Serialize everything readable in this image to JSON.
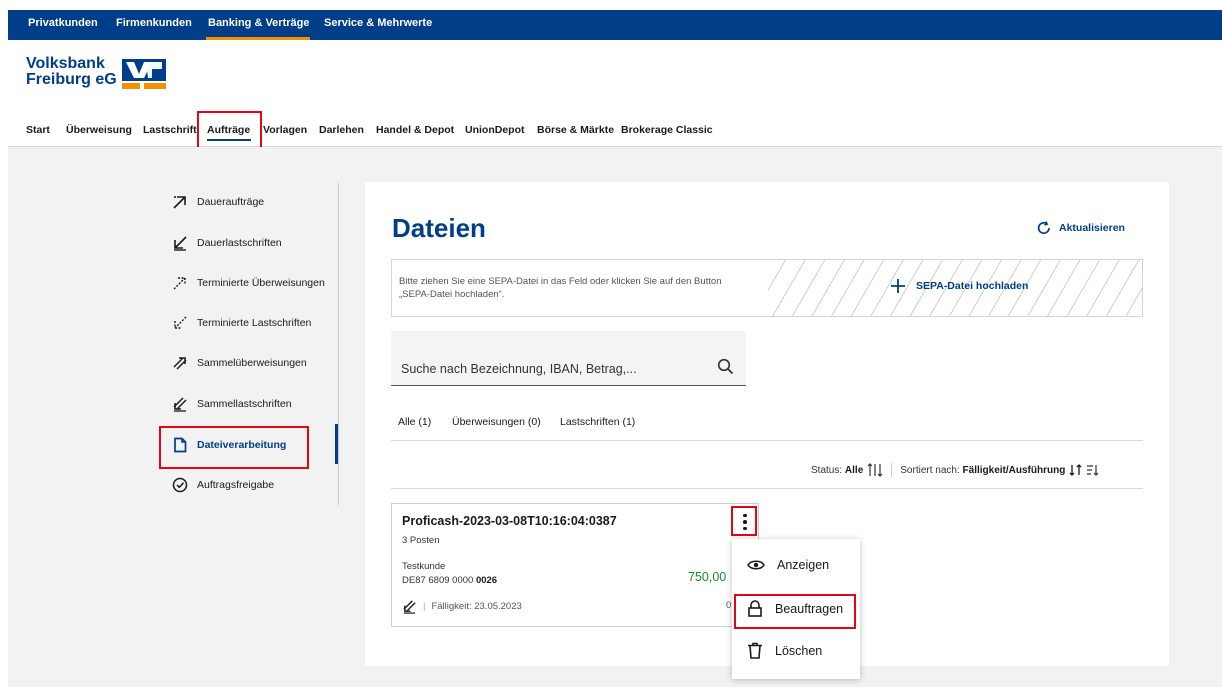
{
  "topnav": {
    "items": [
      "Privatkunden",
      "Firmenkunden",
      "Banking & Verträge",
      "Service & Mehrwerte"
    ]
  },
  "logo": {
    "line1": "Volksbank",
    "line2": "Freiburg eG"
  },
  "subnav": {
    "items": [
      "Start",
      "Überweisung",
      "Lastschrift",
      "Aufträge",
      "Vorlagen",
      "Darlehen",
      "Handel & Depot",
      "UnionDepot",
      "Börse & Märkte",
      "Brokerage Classic"
    ],
    "active": "Aufträge"
  },
  "sidebar": {
    "items": [
      {
        "label": "Daueraufträge",
        "icon": "arrow-up-right-icon"
      },
      {
        "label": "Dauerlastschriften",
        "icon": "arrow-down-left-icon"
      },
      {
        "label": "Terminierte Überweisungen",
        "icon": "dotted-arrow-up-right-icon"
      },
      {
        "label": "Terminierte Lastschriften",
        "icon": "dotted-arrow-down-left-icon"
      },
      {
        "label": "Sammelüberweisungen",
        "icon": "multi-arrow-up-right-icon"
      },
      {
        "label": "Sammellastschriften",
        "icon": "multi-arrow-down-left-icon"
      },
      {
        "label": "Dateiverarbeitung",
        "icon": "file-icon"
      },
      {
        "label": "Auftragsfreigabe",
        "icon": "check-circle-icon"
      }
    ],
    "active": "Dateiverarbeitung"
  },
  "main": {
    "title": "Dateien",
    "refresh_label": "Aktualisieren",
    "dropzone_hint": "Bitte ziehen Sie eine SEPA-Datei in das Feld oder klicken Sie auf den Button „SEPA-Datei hochladen“.",
    "upload_label": "SEPA-Datei hochladen",
    "search_placeholder": "Suche nach Bezeichnung, IBAN, Betrag,...",
    "tabs": [
      "Alle (1)",
      "Überweisungen (0)",
      "Lastschriften (1)"
    ],
    "status_label": "Status:",
    "status_value": "Alle",
    "sort_label": "Sortiert nach:",
    "sort_value": "Fälligkeit/Ausführung"
  },
  "file": {
    "name": "Proficash-2023-03-08T10:16:04:0387",
    "posten": "3 Posten",
    "holder": "Testkunde",
    "iban_prefix": "DE87 6809 0000",
    "iban_suffix": "0026",
    "amount": "750,00",
    "due": "Fälligkeit: 23.05.2023",
    "cut_digit": "0"
  },
  "menu": {
    "items": [
      {
        "label": "Anzeigen",
        "icon": "eye-icon"
      },
      {
        "label": "Beauftragen",
        "icon": "lock-icon"
      },
      {
        "label": "Löschen",
        "icon": "trash-icon"
      }
    ]
  },
  "colors": {
    "brand_blue": "#003e8a",
    "accent_orange": "#f39200",
    "highlight_red": "#e30613",
    "amount_green": "#1a8a2e"
  }
}
